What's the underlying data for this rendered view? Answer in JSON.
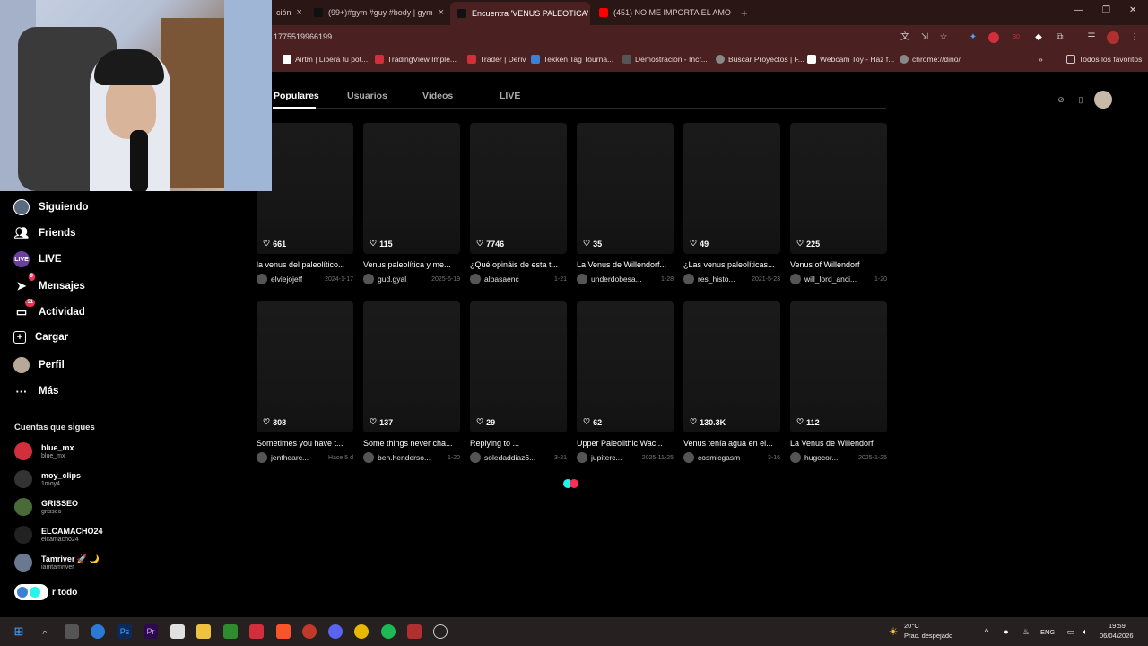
{
  "browser": {
    "tabs": [
      {
        "label": "ción",
        "active": false
      },
      {
        "label": "(99+)#gym #guy #body | gym",
        "active": false
      },
      {
        "label": "Encuentra 'VENUS PALEOTICA'",
        "active": true
      },
      {
        "label": "(451) NO ME IMPORTA EL AMO",
        "active": false
      }
    ],
    "new_tab": "+",
    "url": "1775519966199",
    "bookmarks": [
      "Airtm | Libera tu pot...",
      "TradingView Imple...",
      "Trader | Deriv",
      "Tekken Tag Tourna...",
      "Demostración - Incr...",
      "Buscar Proyectos | F...",
      "Webcam Toy - Haz f...",
      "chrome://dino/"
    ],
    "all_bookmarks": "Todos los favoritos",
    "extension_badge": "30"
  },
  "sidebar": {
    "items": [
      {
        "label": "Siguiendo",
        "icon": "following-avatar-icon"
      },
      {
        "label": "Friends",
        "icon": "friends-icon"
      },
      {
        "label": "LIVE",
        "icon": "live-icon"
      },
      {
        "label": "Mensajes",
        "icon": "messages-icon",
        "badge": "9"
      },
      {
        "label": "Actividad",
        "icon": "activity-icon",
        "badge": "51"
      },
      {
        "label": "Cargar",
        "icon": "upload-icon"
      },
      {
        "label": "Perfil",
        "icon": "profile-avatar-icon"
      },
      {
        "label": "Más",
        "icon": "more-icon"
      }
    ],
    "following_title": "Cuentas que sigues",
    "following": [
      {
        "name": "blue_mx",
        "handle": "blue_mx",
        "color": "#d12f3b"
      },
      {
        "name": "moy_clips",
        "handle": "1moy4",
        "color": "#333333"
      },
      {
        "name": "GRISSEO",
        "handle": "grisseo",
        "color": "#4a6a3a"
      },
      {
        "name": "ELCAMACHO24",
        "handle": "elcamacho24",
        "color": "#222222"
      },
      {
        "name": "Tamriver 🚀 🌙",
        "handle": "iamtamriver",
        "color": "#6a7890"
      }
    ],
    "see_all": "r todo"
  },
  "search_tabs": [
    "Populares",
    "Usuarios",
    "Videos",
    "LIVE"
  ],
  "videos": [
    {
      "likes": "661",
      "caption": "la venus del paleolítico...",
      "user": "elviejojeff",
      "date": "2024-1-17"
    },
    {
      "likes": "115",
      "caption": "Venus paleolítica y me...",
      "user": "gud.gyal",
      "date": "2025-6-19"
    },
    {
      "likes": "7746",
      "caption": "¿Qué opináis de esta t...",
      "user": "albasaenc",
      "date": "1-21"
    },
    {
      "likes": "35",
      "caption": "La Venus de Willendorf...",
      "user": "underdobesa...",
      "date": "1-28"
    },
    {
      "likes": "49",
      "caption": "¿Las venus paleolíticas...",
      "user": "res_histo...",
      "date": "2021-5-23"
    },
    {
      "likes": "225",
      "caption": "Venus of Willendorf",
      "user": "will_lord_anci...",
      "date": "1-20"
    },
    {
      "likes": "308",
      "caption": "Sometimes you have t...",
      "user": "jenthearc...",
      "date": "Hace 5 d"
    },
    {
      "likes": "137",
      "caption": "Some things never cha...",
      "user": "ben.henderso...",
      "date": "1-20"
    },
    {
      "likes": "29",
      "caption": "Replying to ...",
      "user": "soledaddiaz6...",
      "date": "3-21"
    },
    {
      "likes": "62",
      "caption": "Upper Paleolithic Wac...",
      "user": "jupiterc...",
      "date": "2025-11-25"
    },
    {
      "likes": "130.3K",
      "caption": "Venus tenía agua en el...",
      "user": "cosmicgasm",
      "date": "3-16"
    },
    {
      "likes": "112",
      "caption": "La Venus de Willendorf",
      "user": "hugocor...",
      "date": "2025-1-25"
    }
  ],
  "taskbar": {
    "weather_temp": "20°C",
    "weather_desc": "Prac. despejado",
    "lang": "ENG",
    "time": "19:59",
    "date": "06/04/2026"
  },
  "colors": {
    "accent": "#fe2c55",
    "loader_a": "#25f4ee",
    "loader_b": "#fe2c55"
  }
}
